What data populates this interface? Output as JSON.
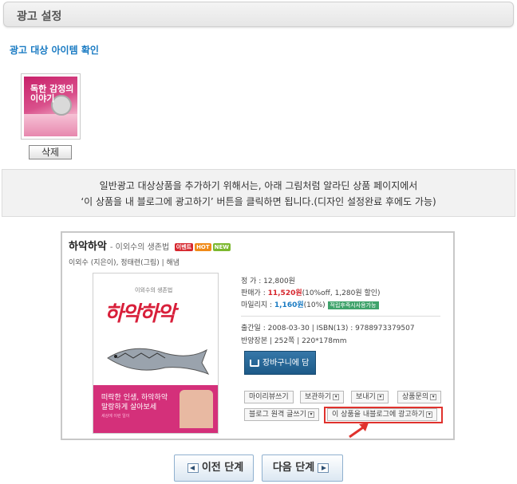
{
  "header": {
    "title": "광고 설정"
  },
  "section": {
    "title": "광고 대상 아이템 확인"
  },
  "item": {
    "thumb_text": "독한 감정의 이야기",
    "delete_label": "삭제"
  },
  "info": {
    "line1": "일반광고 대상상품을 추가하기 위해서는, 아래 그림처럼 알라딘 상품 페이지에서",
    "line2": "‘이 상품을 내 블로그에 광고하기’ 버튼을 클릭하면 됩니다.(디자인 설정완료 후에도 가능)"
  },
  "preview": {
    "title": "하악하악",
    "subtitle": "- 이외수의 생존법",
    "badges": [
      "이벤트",
      "HOT",
      "NEW"
    ],
    "author": "이외수 (지은이), 정태련(그림) | 해냄",
    "book": {
      "small": "이외수의 생존법",
      "title": "하악하악",
      "pink_text": "떠락한 인생, 하악하악\n말랑하게 살아보세",
      "tiny": "세상에 이런 일이"
    },
    "price_label": "정 가 : 12,800원",
    "sale_label": "판매가 : ",
    "sale_price": "11,520원",
    "sale_rest": "(10%off, 1,280원 할인)",
    "mileage_label": "마일리지 : ",
    "mileage_value": "1,160원",
    "mileage_rest": "(10%)",
    "mileage_tag": "적립후즉시사용가능",
    "pub_date": "출간일 : 2008-03-30 | ISBN(13) : 9788973379507",
    "binding": "반양장본 | 252쪽 | 220*178mm",
    "cart_label": "장바구니에 담기",
    "buttons": {
      "review": "마이리뷰쓰기",
      "keep": "보관하기",
      "share": "보내기",
      "inquiry": "상품문의",
      "blog_write": "블로그 원격 글쓰기",
      "ad_blog": "이 상품을 내블로그에 광고하기"
    }
  },
  "nav": {
    "prev": "이전 단계",
    "next": "다음 단계"
  }
}
